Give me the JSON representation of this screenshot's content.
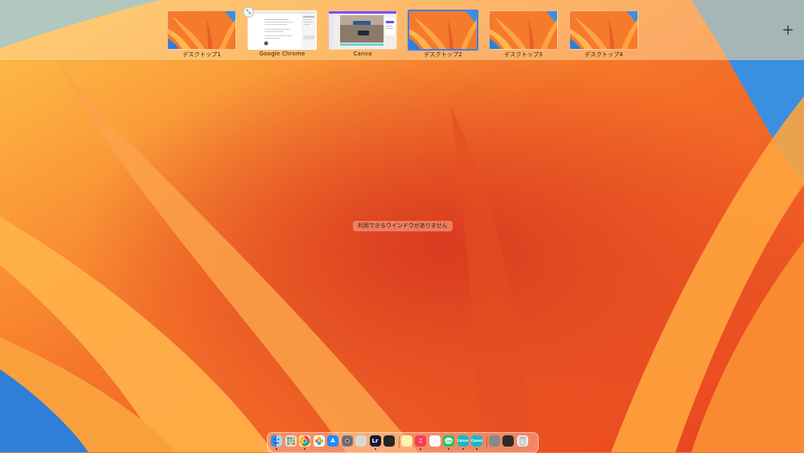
{
  "spaces_bar": {
    "spaces": [
      {
        "label": "デスクトップ1",
        "kind": "desktop",
        "active": false
      },
      {
        "label": "Google Chrome",
        "kind": "chrome",
        "active": false
      },
      {
        "label": "Canva",
        "kind": "canva",
        "active": false
      },
      {
        "label": "デスクトップ2",
        "kind": "desktop",
        "active": true
      },
      {
        "label": "デスクトップ3",
        "kind": "desktop",
        "active": false
      },
      {
        "label": "デスクトップ4",
        "kind": "desktop",
        "active": false
      }
    ],
    "add_label": "+",
    "exit_fullscreen_icon": "arrows-collapse-icon"
  },
  "desktop": {
    "message": "利用できるウインドウがありません"
  },
  "dock": {
    "items": [
      {
        "name": "finder-icon",
        "color": "#3ba0f5",
        "glyph": ""
      },
      {
        "name": "launchpad-icon",
        "color": "#e4e4e4",
        "glyph": ""
      },
      {
        "name": "chrome-icon",
        "color": "#ffffff",
        "glyph": ""
      },
      {
        "name": "photos-icon",
        "color": "#ffffff",
        "glyph": ""
      },
      {
        "name": "app-store-icon",
        "color": "#1a8cff",
        "glyph": "A"
      },
      {
        "name": "system-settings-icon",
        "color": "#7a7a7a",
        "glyph": ""
      },
      {
        "name": "script-icon",
        "color": "#d8d8d8",
        "glyph": ""
      },
      {
        "name": "lightroom-icon",
        "color": "#0a1a33",
        "glyph": "Lr"
      },
      {
        "name": "davinci-icon",
        "color": "#262626",
        "glyph": ""
      },
      {
        "name": "notes-icon",
        "color": "#fff4b0",
        "glyph": ""
      },
      {
        "name": "music-icon",
        "color": "#fa3b55",
        "glyph": "♫"
      },
      {
        "name": "photobooth-icon",
        "color": "#fbfbfb",
        "glyph": ""
      },
      {
        "name": "line-icon",
        "color": "#1ec85a",
        "glyph": ""
      },
      {
        "name": "canva-icon",
        "color": "#16b9c9",
        "glyph": "Canva"
      },
      {
        "name": "canva-icon-2",
        "color": "#16b9c9",
        "glyph": "Canva"
      },
      {
        "name": "preview-icon",
        "color": "#8a8a8a",
        "glyph": ""
      },
      {
        "name": "screenshot-icon",
        "color": "#2b2b2b",
        "glyph": ""
      },
      {
        "name": "trash-icon",
        "color": "#cfcfcf",
        "glyph": ""
      }
    ],
    "running": [
      true,
      false,
      true,
      false,
      false,
      false,
      false,
      true,
      false,
      false,
      true,
      false,
      true,
      true,
      true,
      false,
      false,
      false
    ]
  }
}
